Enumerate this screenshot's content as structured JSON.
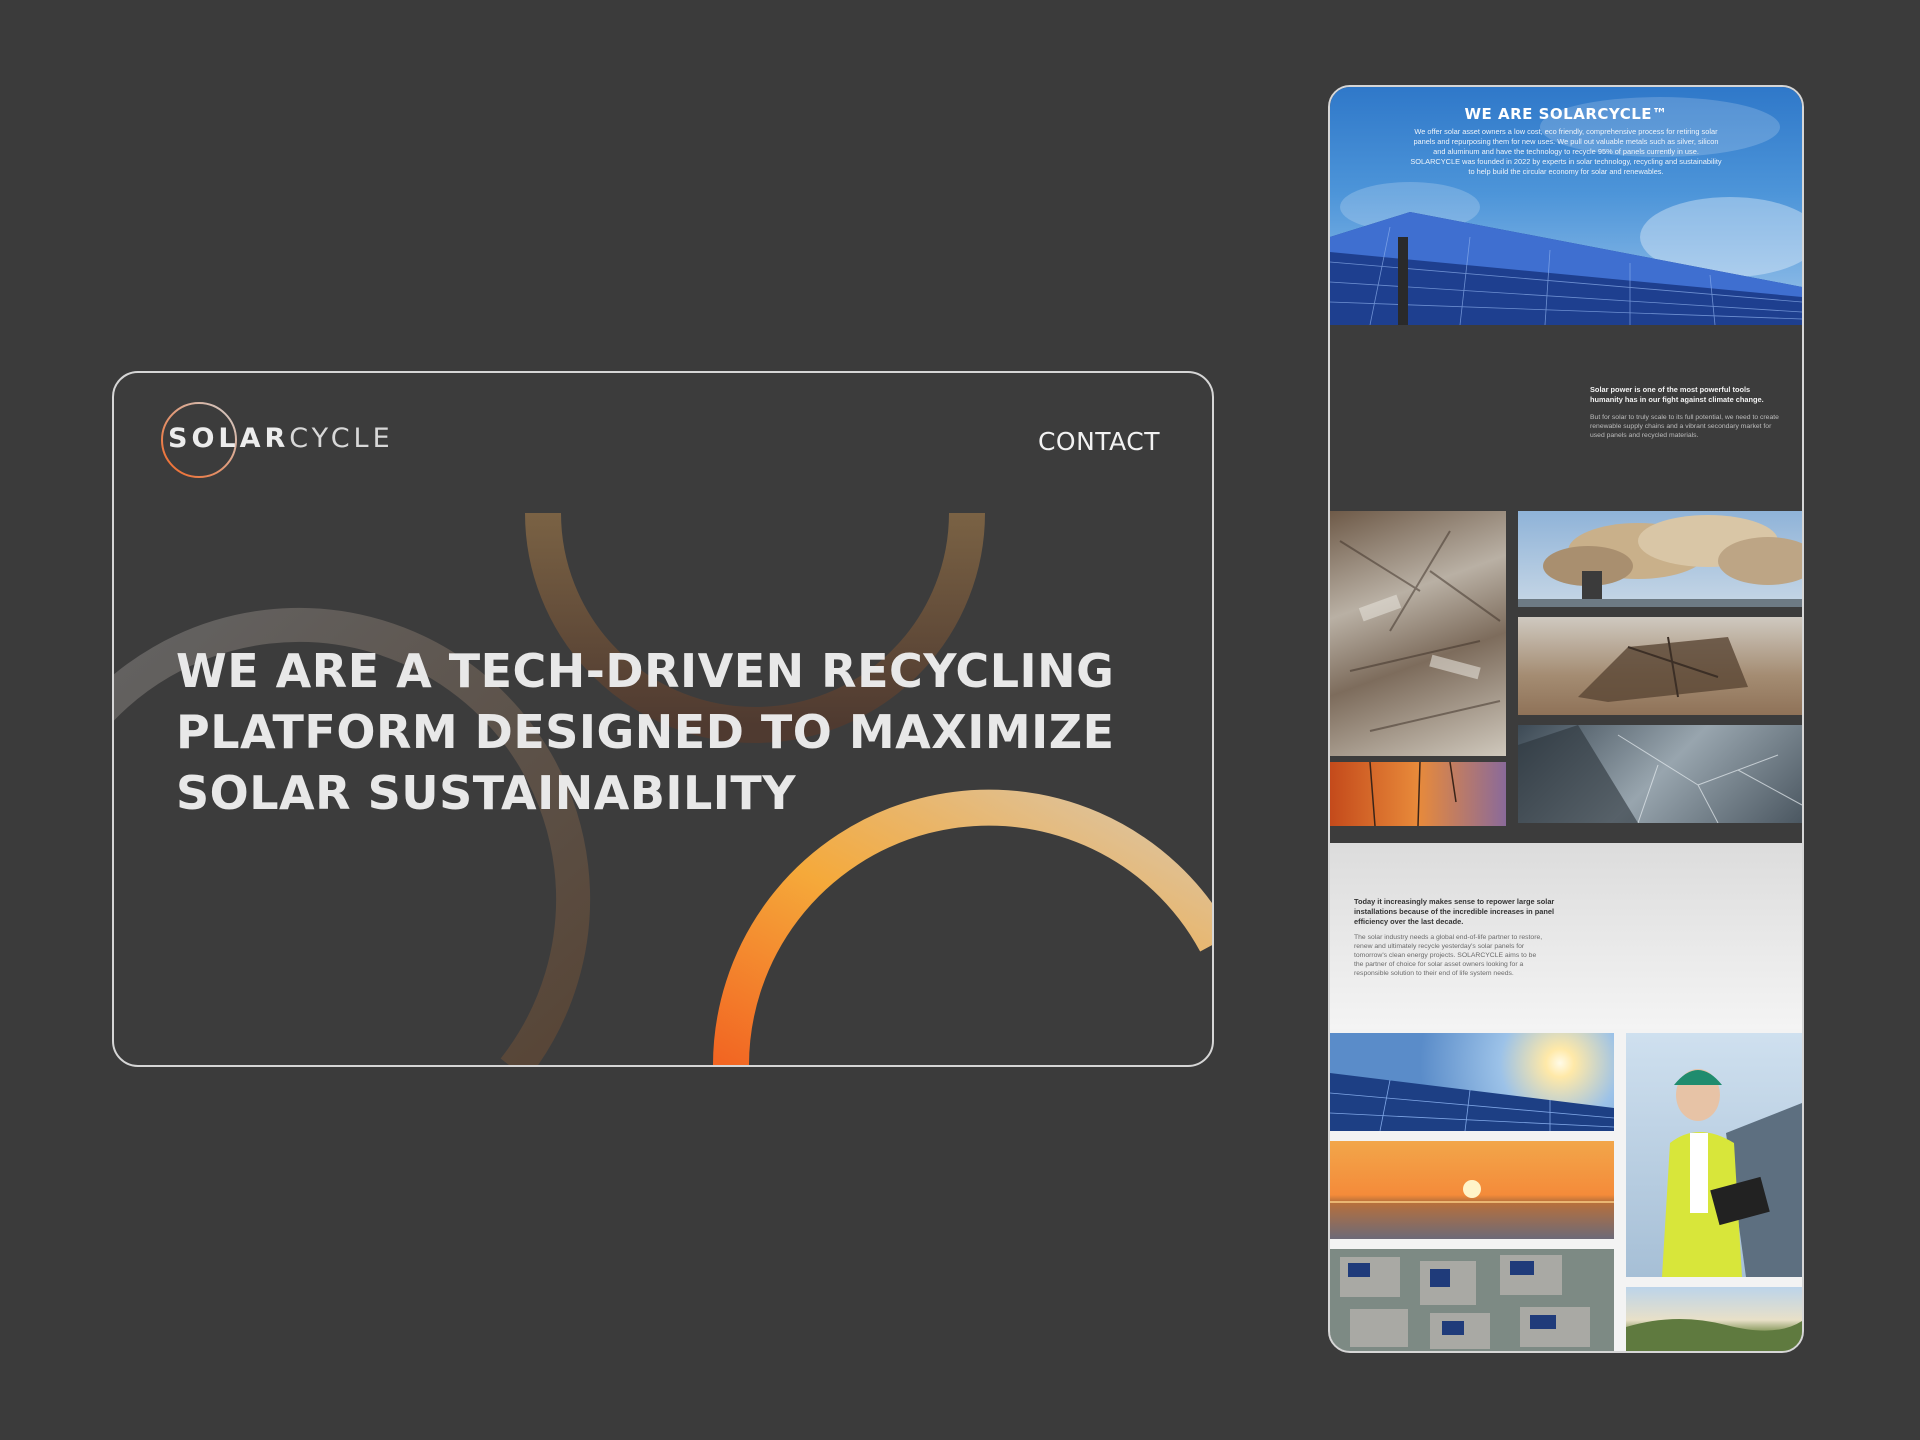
{
  "desktop": {
    "logo": {
      "bold": "SOLA",
      "light_r": "R",
      "cycle": "CYCLE"
    },
    "nav": {
      "contact": "CONTACT"
    },
    "headline": [
      "WE ARE A TECH-DRIVEN RECYCLING",
      "PLATFORM DESIGNED TO MAXIMIZE",
      "SOLAR SUSTAINABILITY"
    ],
    "colors": {
      "background": "#3c3c3c",
      "accent_orange": "#f26522",
      "accent_gold": "#f5a93a",
      "accent_sand": "#d9c7ad"
    }
  },
  "mobile": {
    "hero": {
      "title": "WE ARE SOLARCYCLE™",
      "body": "We offer solar asset owners a low cost, eco friendly, comprehensive process for retiring solar panels and repurposing them for new uses. We pull out valuable metals such as silver, silicon and aluminum and have the technology to recycle 95% of panels currently in use. SOLARCYCLE was founded in 2022 by experts in solar technology, recycling and sustainability to help build the circular economy for solar and renewables."
    },
    "section2": {
      "lead": "Solar power is one of the most powerful tools humanity has in our fight against climate change.",
      "body": "But for solar to truly scale to its full potential, we need to create renewable supply chains and a vibrant secondary market for used panels and recycled materials."
    },
    "section3": {
      "lead": "Today it increasingly makes sense to repower large solar installations because of the incredible increases in panel efficiency over the last decade.",
      "body": "The solar industry needs a global end-of-life partner to restore, renew and ultimately recycle yesterday's solar panels for tomorrow's clean energy projects. SOLARCYCLE aims to be the partner of choice for solar asset owners looking for a responsible solution to their end of life system needs."
    },
    "images": [
      "solar-panels-sky-photo",
      "scrap-metal-photo",
      "smokestack-photo",
      "mining-excavator-photo",
      "polluted-water-photo",
      "broken-panel-photo",
      "panels-sun-photo",
      "sunset-sea-photo",
      "rooftops-aerial-photo",
      "engineer-woman-photo",
      "hills-landscape-photo"
    ]
  }
}
